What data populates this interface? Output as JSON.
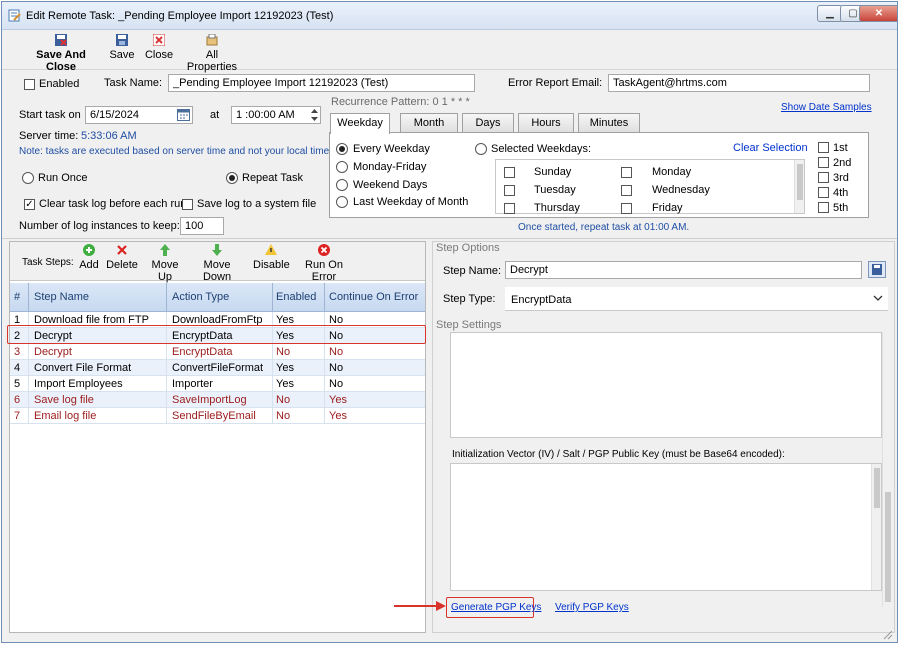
{
  "window": {
    "title": "Edit Remote Task: _Pending Employee Import 12192023 (Test)",
    "controls": [
      "minimize",
      "maximize",
      "close"
    ]
  },
  "toolbar": {
    "save_and_close": "Save And Close",
    "save": "Save",
    "close": "Close",
    "all_properties": "All Properties"
  },
  "task": {
    "enabled_label": "Enabled",
    "enabled": false,
    "task_name_label": "Task Name:",
    "task_name": "_Pending Employee Import 12192023 (Test)",
    "error_email_label": "Error Report Email:",
    "error_email": "TaskAgent@hrtms.com"
  },
  "schedule": {
    "start_label": "Start task on",
    "start_date": "6/15/2024",
    "at_label": "at",
    "start_time": "1 :00:00 AM",
    "server_time_label": "Server time:",
    "server_time": "5:33:06 AM",
    "note": "Note: tasks are executed based on server time and not your local time!",
    "run_once": "Run Once",
    "repeat_task": "Repeat Task",
    "clear_log": "Clear task log before each run",
    "save_log": "Save log to a system file",
    "log_instances_label": "Number of log instances to keep:",
    "log_instances": "100"
  },
  "recurrence": {
    "pattern_label": "Recurrence Pattern: 0 1 * * *",
    "show_samples": "Show Date Samples",
    "tabs": [
      "Weekday",
      "Month",
      "Days",
      "Hours",
      "Minutes"
    ],
    "active_tab": "Weekday",
    "options": [
      "Every Weekday",
      "Monday-Friday",
      "Weekend Days",
      "Last Weekday of Month"
    ],
    "selected_weekdays": "Selected Weekdays:",
    "clear_selection": "Clear Selection",
    "days_col1": [
      "Sunday",
      "Tuesday",
      "Thursday"
    ],
    "days_col2": [
      "Monday",
      "Wednesday",
      "Friday"
    ],
    "weeks": [
      "1st",
      "2nd",
      "3rd",
      "4th",
      "5th"
    ],
    "summary": "Once started, repeat task at 01:00 AM."
  },
  "steps_toolbar": {
    "label": "Task Steps:",
    "add": "Add",
    "delete": "Delete",
    "move_up": "Move Up",
    "move_down": "Move Down",
    "disable": "Disable",
    "run_on_error": "Run On Error"
  },
  "grid": {
    "headers": [
      "#",
      "Step Name",
      "Action Type",
      "Enabled",
      "Continue On Error"
    ],
    "rows": [
      {
        "num": "1",
        "name": "Download file from FTP",
        "action": "DownloadFromFtp",
        "enabled": "Yes",
        "continue": "No"
      },
      {
        "num": "2",
        "name": "Decrypt",
        "action": "EncryptData",
        "enabled": "Yes",
        "continue": "No"
      },
      {
        "num": "3",
        "name": "Decrypt",
        "action": "EncryptData",
        "enabled": "No",
        "continue": "No"
      },
      {
        "num": "4",
        "name": "Convert File Format",
        "action": "ConvertFileFormat",
        "enabled": "Yes",
        "continue": "No"
      },
      {
        "num": "5",
        "name": "Import Employees",
        "action": "Importer",
        "enabled": "Yes",
        "continue": "No"
      },
      {
        "num": "6",
        "name": "Save log file",
        "action": "SaveImportLog",
        "enabled": "No",
        "continue": "Yes"
      },
      {
        "num": "7",
        "name": "Email log file",
        "action": "SendFileByEmail",
        "enabled": "No",
        "continue": "Yes"
      }
    ]
  },
  "step_options": {
    "section_label": "Step Options",
    "step_name_label": "Step Name:",
    "step_name": "Decrypt",
    "step_type_label": "Step Type:",
    "step_type": "EncryptData",
    "settings_label": "Step Settings",
    "iv_label": "Initialization Vector (IV) / Salt / PGP Public Key (must be Base64 encoded):",
    "generate_keys": "Generate PGP Keys",
    "verify_keys": "Verify PGP Keys"
  },
  "colors": {
    "highlight": "#d9342b",
    "link": "#0033cc",
    "note_blue": "#1f4ea3",
    "disabled_row": "#9b1b1b"
  }
}
